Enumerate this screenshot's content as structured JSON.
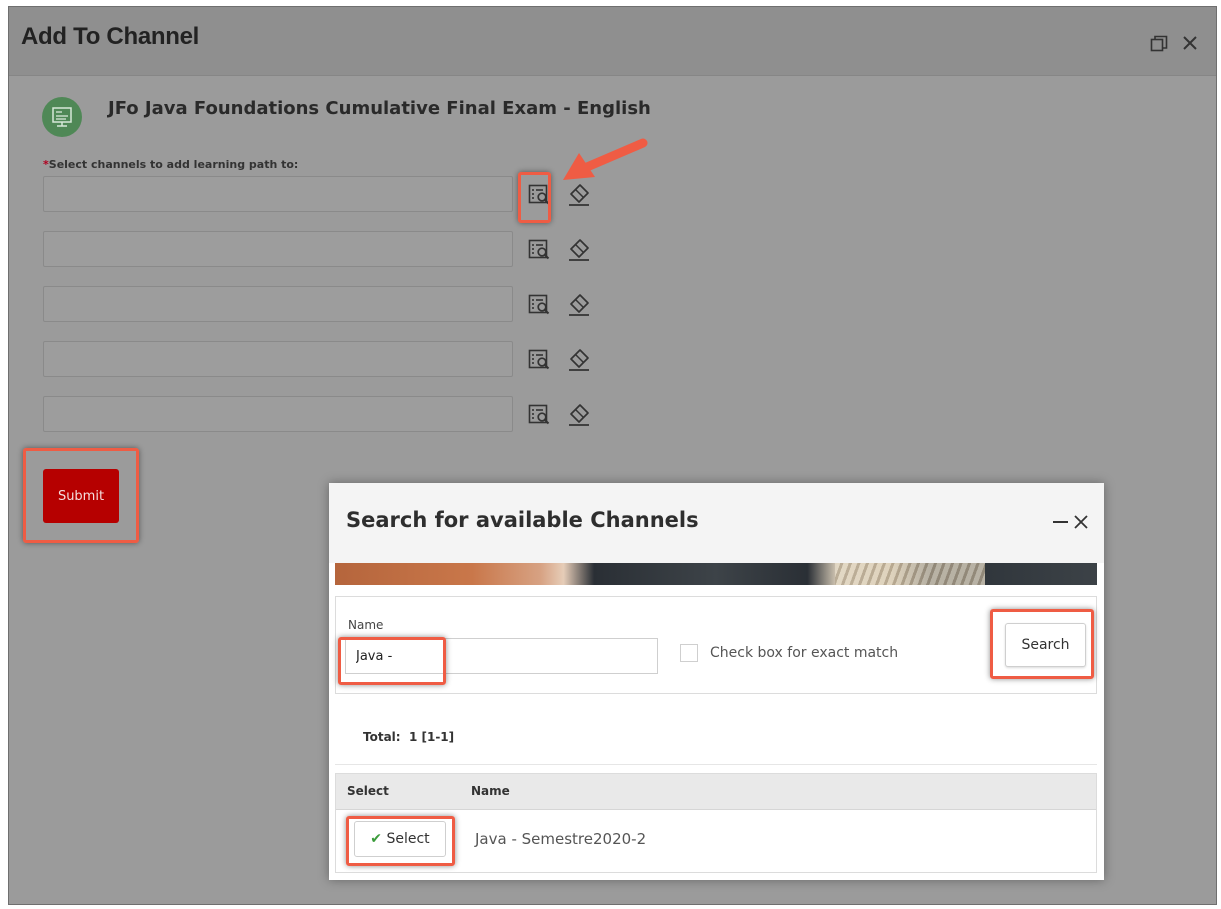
{
  "dialog": {
    "title": "Add To Channel",
    "course_title": "JFo Java Foundations Cumulative Final Exam - English",
    "required_marker": "*",
    "field_label": "Select channels to add learning path to:",
    "submit_label": "Submit",
    "channel_inputs": [
      "",
      "",
      "",
      "",
      ""
    ]
  },
  "modal": {
    "title": "Search for available Channels",
    "name_label": "Name",
    "name_value": "Java -",
    "exact_match_label": "Check box for exact match",
    "exact_match_checked": false,
    "search_label": "Search",
    "total_label": "Total:",
    "total_value": "1 [1-1]",
    "columns": [
      "Select",
      "Name"
    ],
    "rows": [
      {
        "select_label": "Select",
        "name": "Java - Semestre2020-2"
      }
    ]
  },
  "colors": {
    "submit_bg": "#b60000",
    "highlight": "#ef5c44",
    "course_icon": "#4f8856",
    "check": "#3a9b3a"
  },
  "icons": {
    "restore": "restore-window-icon",
    "close": "close-icon",
    "lookup": "lookup-list-icon",
    "eraser": "eraser-icon",
    "course": "course-monitor-icon",
    "check": "checkmark-icon"
  }
}
